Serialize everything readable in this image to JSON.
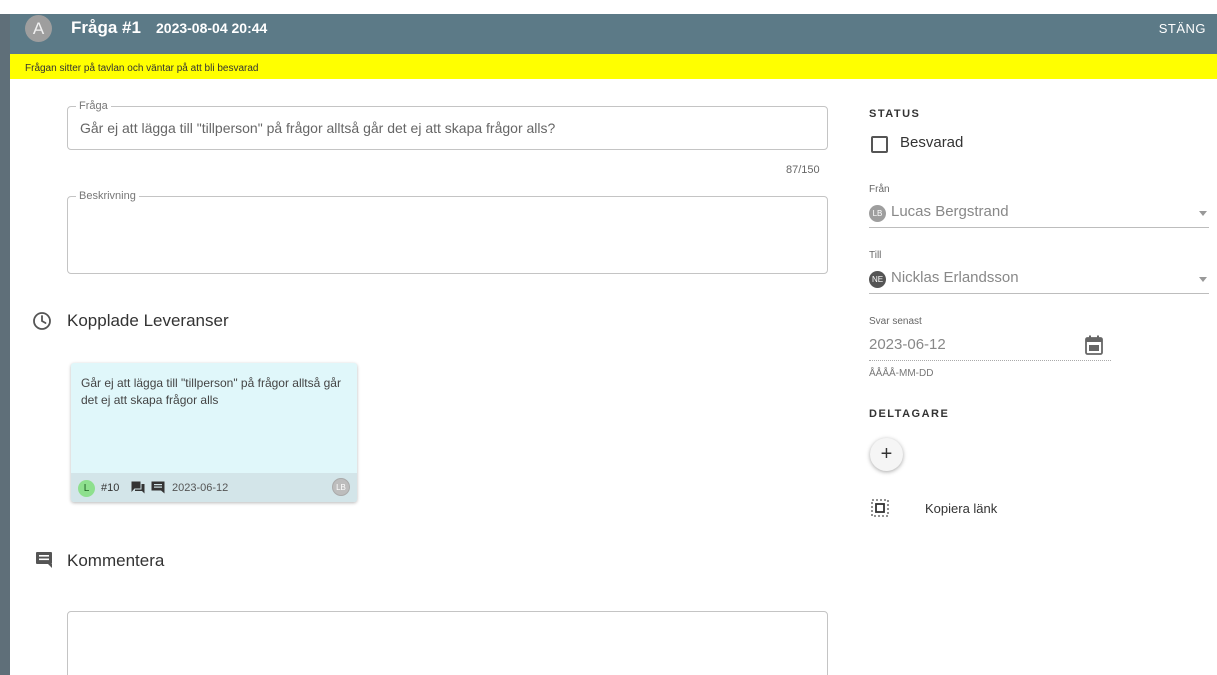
{
  "header": {
    "avatar_letter": "A",
    "title": "Fråga #1",
    "datetime": "2023-08-04 20:44",
    "close_label": "STÄNG",
    "color": "#5c7a87"
  },
  "notice": {
    "text": "Frågan sitter på tavlan och väntar på att bli besvarad",
    "color": "#ffff00"
  },
  "form": {
    "question_legend": "Fråga",
    "question_value": "Går ej att lägga till \"tillperson\" på frågor alltså går det ej att skapa frågor alls?",
    "counter": "87/150",
    "description_legend": "Beskrivning",
    "description_value": ""
  },
  "linked": {
    "title": "Kopplade Leveranser",
    "icon": "clock-icon",
    "card": {
      "text": "Går ej att lägga till \"tillperson\" på frågor alltså går det ej att skapa frågor alls",
      "status_letter": "L",
      "number": "#10",
      "date": "2023-06-12",
      "assignee_initials": "LB",
      "color": "#e0f7fa"
    }
  },
  "comment": {
    "title": "Kommentera",
    "icon": "comment-icon"
  },
  "sidebar": {
    "status_label": "STATUS",
    "answered_label": "Besvarad",
    "answered_checked": false,
    "from_label": "Från",
    "from_initials": "LB",
    "from_name": "Lucas Bergstrand",
    "to_label": "Till",
    "to_initials": "NE",
    "to_name": "Nicklas Erlandsson",
    "deadline_label": "Svar senast",
    "deadline_value": "2023-06-12",
    "deadline_hint": "ÅÅÅÅ-MM-DD",
    "participants_label": "DELTAGARE",
    "add_symbol": "+",
    "copy_link_label": "Kopiera länk"
  }
}
